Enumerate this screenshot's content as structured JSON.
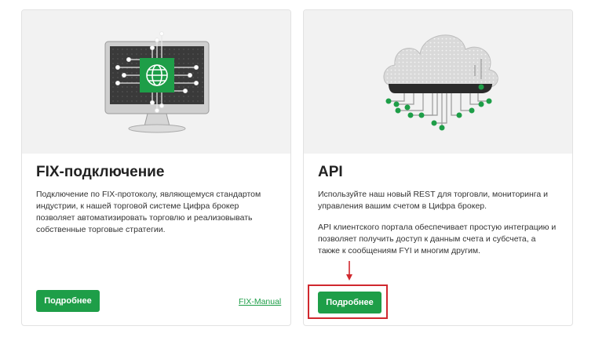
{
  "cards": [
    {
      "title": "FIX-подключение",
      "description": "Подключение по FIX-протоколу, являющемуся стандартом индустрии, к нашей торговой системе Цифра брокер позволяет автоматизировать торговлю и реализовывать собственные торговые стратегии.",
      "button_label": "Подробнее",
      "link_label": "FIX-Manual",
      "hero_icon": "monitor-globe-network-icon"
    },
    {
      "title": "API",
      "description": "Используйте наш новый REST для торговли, мониторинга и управления вашим счетом в Цифра брокер.",
      "description2": "API клиентского портала обеспечивает простую интеграцию и позволяет получить доступ к данным счета и субсчета, а также к сообщениям FYI и многим другим.",
      "button_label": "Подробнее",
      "hero_icon": "cloud-network-icon"
    }
  ],
  "colors": {
    "accent": "#1e9e48",
    "highlight": "#d0282e",
    "card_bg": "#f2f2f2"
  }
}
